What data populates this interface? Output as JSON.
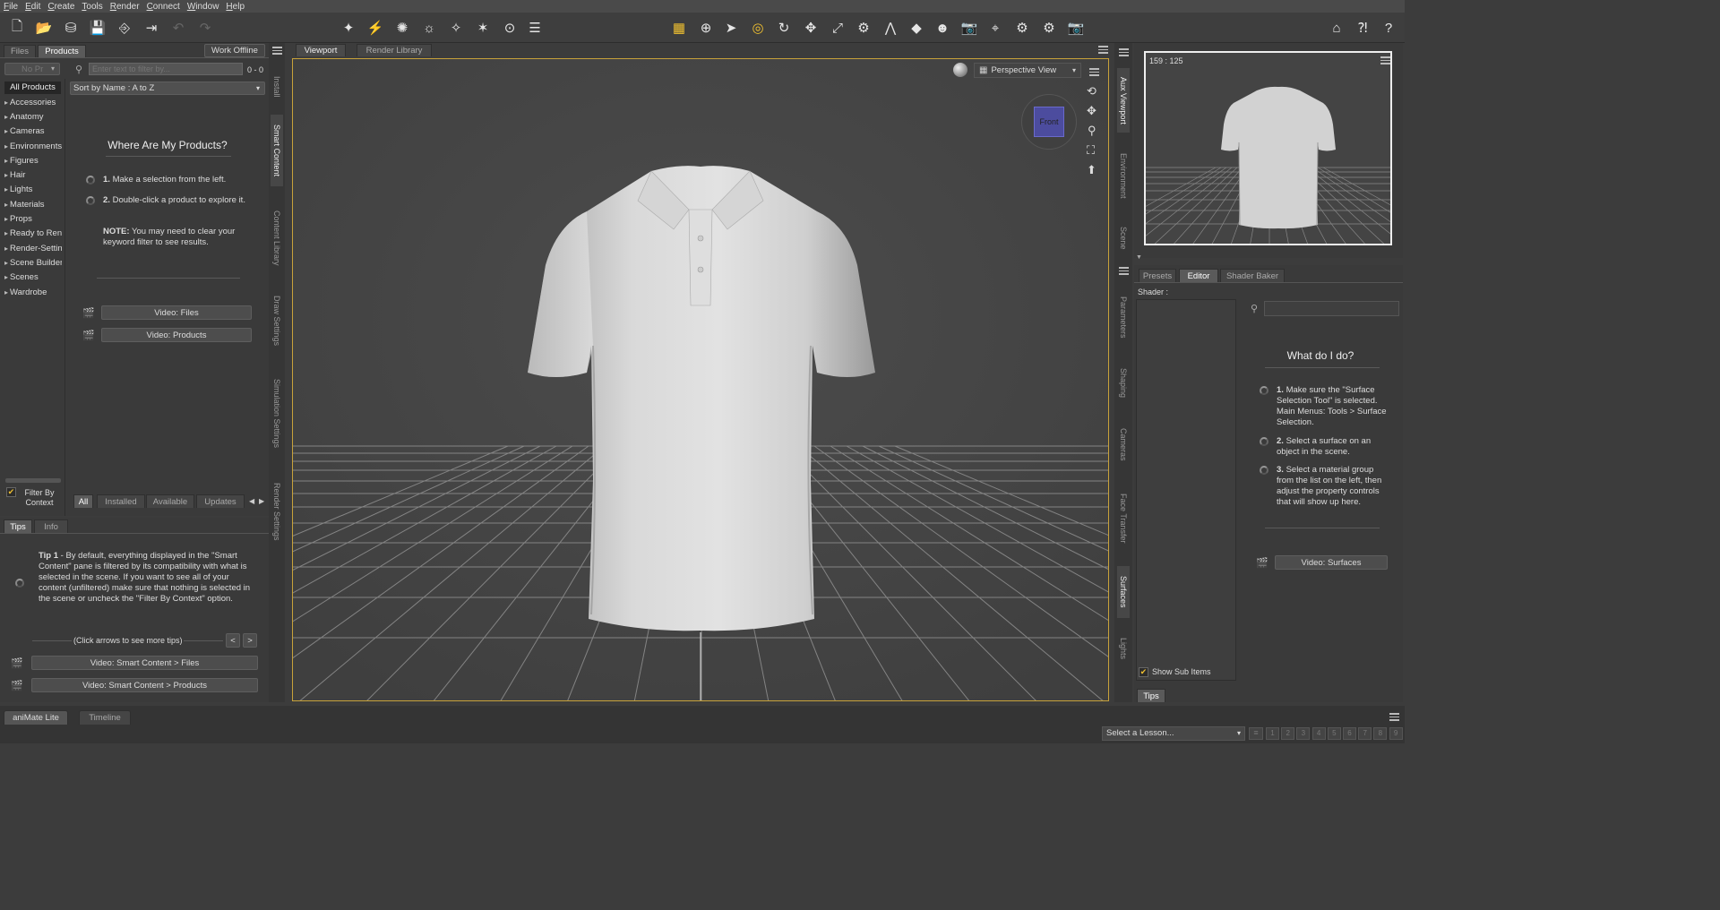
{
  "menu": [
    "File",
    "Edit",
    "Create",
    "Tools",
    "Render",
    "Connect",
    "Window",
    "Help"
  ],
  "left": {
    "tabs": [
      "Files",
      "Products"
    ],
    "work_offline": "Work Offline",
    "filter_dropdown": "No Pr",
    "search_placeholder": "Enter text to filter by...",
    "count": "0 - 0",
    "all_products": "All Products",
    "sort": "Sort by Name : A to Z",
    "categories": [
      "Accessories",
      "Anatomy",
      "Cameras",
      "Environments",
      "Figures",
      "Hair",
      "Lights",
      "Materials",
      "Props",
      "Ready to Render",
      "Render-Settings",
      "Scene Builder",
      "Scenes",
      "Wardrobe"
    ],
    "heading": "Where Are My Products?",
    "step1_num": "1.",
    "step1": "Make a selection from the left.",
    "step2_num": "2.",
    "step2": "Double-click a product to explore it.",
    "note_label": "NOTE:",
    "note": "You may need to clear your keyword filter to see results.",
    "video_files": "Video: Files",
    "video_products": "Video: Products",
    "filter_by_context": "Filter By Context",
    "bottom_tabs": [
      "All",
      "Installed",
      "Available",
      "Updates"
    ],
    "side_tabs": [
      "Install",
      "Smart Content",
      "Content Library",
      "Draw Settings",
      "Simulation Settings",
      "Render Settings"
    ]
  },
  "tips": {
    "tabs": [
      "Tips",
      "Info"
    ],
    "tip_label": "Tip 1",
    "tip_text": "- By default, everything displayed in the \"Smart Content\" pane is filtered by its compatibility with what is selected in the scene. If you want to see all of your content (unfiltered) make sure that nothing is selected in the scene or uncheck the \"Filter By Context\" option.",
    "nav_hint": "(Click arrows to see more tips)",
    "prev": "<",
    "next": ">",
    "video1": "Video: Smart Content > Files",
    "video2": "Video: Smart Content > Products"
  },
  "viewport": {
    "tabs": [
      "Viewport",
      "Render Library"
    ],
    "view": "Perspective View",
    "cube": "Front"
  },
  "aux": {
    "side_tabs": [
      "Aux Viewport",
      "Environment",
      "Scene"
    ],
    "ratio": "159 : 125"
  },
  "surfaces": {
    "tabs": [
      "Presets",
      "Editor",
      "Shader Baker"
    ],
    "shader_label": "Shader :",
    "heading": "What do I do?",
    "step1_num": "1.",
    "step1": "Make sure the \"Surface Selection Tool\" is selected. Main Menus: Tools > Surface Selection.",
    "step2_num": "2.",
    "step2": "Select a surface on an object in the scene.",
    "step3_num": "3.",
    "step3": "Select a material group from the list on the left, then adjust the property controls that will show up here.",
    "video": "Video: Surfaces",
    "show_sub": "Show Sub Items",
    "tips_tab": "Tips",
    "side_tabs": [
      "Parameters",
      "Shaping",
      "Cameras",
      "Face Transfer",
      "Surfaces",
      "Lights"
    ]
  },
  "bottom": {
    "tabs": [
      "aniMate Lite",
      "Timeline"
    ],
    "lesson": "Select a Lesson...",
    "steps": [
      "1",
      "2",
      "3",
      "4",
      "5",
      "6",
      "7",
      "8",
      "9"
    ]
  },
  "colors": {
    "accent": "#f0c030",
    "cube": "#4c4ca6",
    "bg": "#3c3c3c"
  }
}
